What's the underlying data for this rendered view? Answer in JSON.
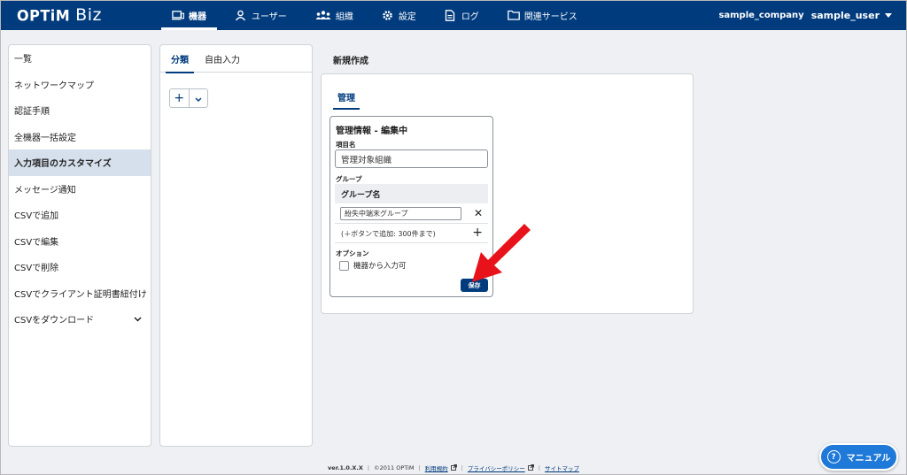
{
  "header": {
    "logo_main": "OPTiM",
    "logo_sub": "Biz",
    "nav": [
      {
        "label": "機器",
        "icon": "device-icon",
        "active": true
      },
      {
        "label": "ユーザー",
        "icon": "user-icon",
        "active": false
      },
      {
        "label": "組織",
        "icon": "organization-icon",
        "active": false
      },
      {
        "label": "設定",
        "icon": "gear-icon",
        "active": false
      },
      {
        "label": "ログ",
        "icon": "log-document-icon",
        "active": false
      },
      {
        "label": "関連サービス",
        "icon": "folder-icon",
        "active": false
      }
    ],
    "company": "sample_company",
    "user": "sample_user"
  },
  "sidebar": {
    "items": [
      {
        "label": "一覧"
      },
      {
        "label": "ネットワークマップ"
      },
      {
        "label": "認証手順"
      },
      {
        "label": "全機器一括設定"
      },
      {
        "label": "入力項目のカスタマイズ",
        "active": true
      },
      {
        "label": "メッセージ通知"
      },
      {
        "label": "CSVで追加"
      },
      {
        "label": "CSVで編集"
      },
      {
        "label": "CSVで削除"
      },
      {
        "label": "CSVでクライアント証明書紐付け"
      },
      {
        "label": "CSVをダウンロード",
        "has_chevron": true
      }
    ]
  },
  "panel2": {
    "tabs": [
      {
        "label": "分類",
        "active": true
      },
      {
        "label": "自由入力",
        "active": false
      }
    ],
    "add_symbol": "+"
  },
  "main": {
    "title": "新規作成",
    "tab": "管理",
    "edit": {
      "title": "管理情報 - 編集中",
      "item_name_label": "項目名",
      "item_name_value": "管理対象組織",
      "group_label": "グループ",
      "group_header": "グループ名",
      "group_value": "紛失中端末グループ",
      "remove_symbol": "✕",
      "add_hint": "(＋ボタンで追加: 300件まで)",
      "add_symbol": "+",
      "option_label": "オプション",
      "checkbox_label": "機器から入力可",
      "checkbox_checked": false,
      "save_label": "保存"
    }
  },
  "footer": {
    "version": "ver.1.0.X.X",
    "copyright": "©2011 OPTiM",
    "terms": "利用規約",
    "privacy": "プライバシーポリシー",
    "sitemap": "サイトマップ"
  },
  "manual": {
    "label": "マニュアル",
    "icon_glyph": "?"
  },
  "colors": {
    "brand": "#003b7e",
    "arrow": "#e8131a",
    "manual": "#1e79d8",
    "active_sidebar": "#d6e0ec"
  }
}
